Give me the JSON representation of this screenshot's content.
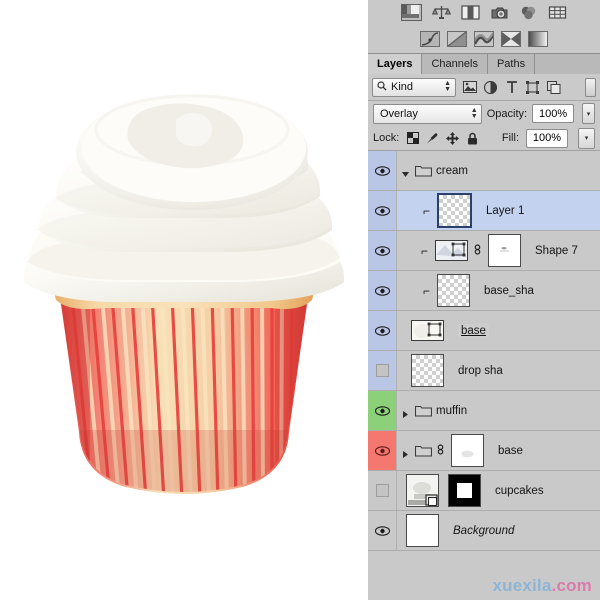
{
  "app": {
    "name": "Adobe Photoshop Layers Panel",
    "watermark": {
      "part1": "xuexila",
      "part2": ".com",
      "color1": "#6aa8dd",
      "color2": "#e84a9a"
    }
  },
  "canvas": {
    "artwork_name": "cupcake-illustration",
    "description": "Illustrated vanilla cupcake with swirled white frosting and red-and-cream striped paper liner on white background",
    "colors": {
      "background": "#ffffff",
      "frosting_light": "#fdfcf8",
      "frosting_shadow": "#e3e1da",
      "cake_top": "#f0c183",
      "cake_light": "#f8dfb4",
      "liner_red": "#ee4540",
      "liner_pink": "#f4796e",
      "liner_cream": "#f7e3bd"
    }
  },
  "adjustments": {
    "row1": [
      {
        "name": "brightness-contrast-icon",
        "glyph": "levels"
      },
      {
        "name": "levels-icon",
        "glyph": "balance"
      },
      {
        "name": "exposure-icon",
        "glyph": "half"
      },
      {
        "name": "photo-filter-icon",
        "glyph": "camera"
      },
      {
        "name": "color-balance-icon",
        "glyph": "venn"
      },
      {
        "name": "channel-mixer-icon",
        "glyph": "grid"
      }
    ],
    "row2": [
      {
        "name": "curves-icon",
        "glyph": "curve"
      },
      {
        "name": "hue-saturation-icon",
        "glyph": "diag"
      },
      {
        "name": "selective-color-icon",
        "glyph": "squiggle"
      },
      {
        "name": "invert-icon",
        "glyph": "x"
      },
      {
        "name": "gradient-map-icon",
        "glyph": "gradient"
      }
    ]
  },
  "tabs": [
    {
      "label": "Layers",
      "active": true
    },
    {
      "label": "Channels",
      "active": false
    },
    {
      "label": "Paths",
      "active": false
    }
  ],
  "filter_bar": {
    "kind_label": "Kind",
    "search_icon": "search-icon",
    "icons": [
      {
        "name": "filter-pixel-icon"
      },
      {
        "name": "filter-adjustment-icon"
      },
      {
        "name": "filter-type-icon"
      },
      {
        "name": "filter-shape-icon"
      },
      {
        "name": "filter-smartobject-icon"
      }
    ],
    "toggle": "filter-enable-toggle"
  },
  "blend_bar": {
    "blend_mode": "Overlay",
    "opacity_label": "Opacity:",
    "opacity_value": "100%",
    "fill_label": "Fill:",
    "fill_value": "100%"
  },
  "lock_bar": {
    "label": "Lock:",
    "items": [
      {
        "name": "lock-transparent-pixels-icon"
      },
      {
        "name": "lock-image-pixels-icon"
      },
      {
        "name": "lock-position-icon"
      },
      {
        "name": "lock-all-icon"
      }
    ]
  },
  "layers": [
    {
      "name": "cream",
      "visible": true,
      "type": "group",
      "expanded": true,
      "indent": 0,
      "selected": false,
      "color_label": "none",
      "has_thumb": false,
      "clipped": false
    },
    {
      "name": "Layer 1",
      "visible": true,
      "type": "pixel",
      "indent": 1,
      "selected": true,
      "color_label": "none",
      "has_thumb": true,
      "thumb_style": "checker",
      "clipped": true
    },
    {
      "name": "Shape 7",
      "visible": true,
      "type": "shape",
      "indent": 1,
      "selected": false,
      "color_label": "none",
      "has_thumb": true,
      "thumb_style": "shape-with-mask",
      "has_link": true,
      "has_vector_mask": true,
      "clipped": true
    },
    {
      "name": "base_sha",
      "visible": true,
      "type": "pixel",
      "indent": 1,
      "selected": false,
      "color_label": "none",
      "has_thumb": true,
      "thumb_style": "checker",
      "clipped": true
    },
    {
      "name": "base",
      "visible": true,
      "type": "shape",
      "indent": 0,
      "selected": false,
      "color_label": "none",
      "has_thumb": true,
      "thumb_style": "shape-blob",
      "editing": true,
      "clipped": false
    },
    {
      "name": "drop sha",
      "visible": false,
      "type": "pixel",
      "indent": 0,
      "selected": false,
      "color_label": "none",
      "has_thumb": true,
      "thumb_style": "checker",
      "clipped": false
    },
    {
      "name": "muffin",
      "visible": true,
      "type": "group",
      "expanded": false,
      "indent": 0,
      "selected": false,
      "color_label": "#8cd17a",
      "has_thumb": false,
      "clipped": false
    },
    {
      "name": "base",
      "visible": true,
      "type": "group",
      "expanded": false,
      "indent": 0,
      "selected": false,
      "color_label": "#f4786f",
      "has_thumb": true,
      "thumb_style": "white-blob",
      "has_link": true,
      "clipped": false
    },
    {
      "name": "cupcakes",
      "visible": false,
      "type": "smart-object",
      "indent": 0,
      "selected": false,
      "color_label": "none",
      "has_thumb": true,
      "thumb_style": "smart-object",
      "has_mask": true,
      "mask_style": "black-white-square",
      "clipped": false
    },
    {
      "name": "Background",
      "visible": true,
      "type": "background",
      "indent": 0,
      "selected": false,
      "color_label": "none",
      "has_thumb": true,
      "thumb_style": "white",
      "italic": true,
      "clipped": false
    }
  ]
}
